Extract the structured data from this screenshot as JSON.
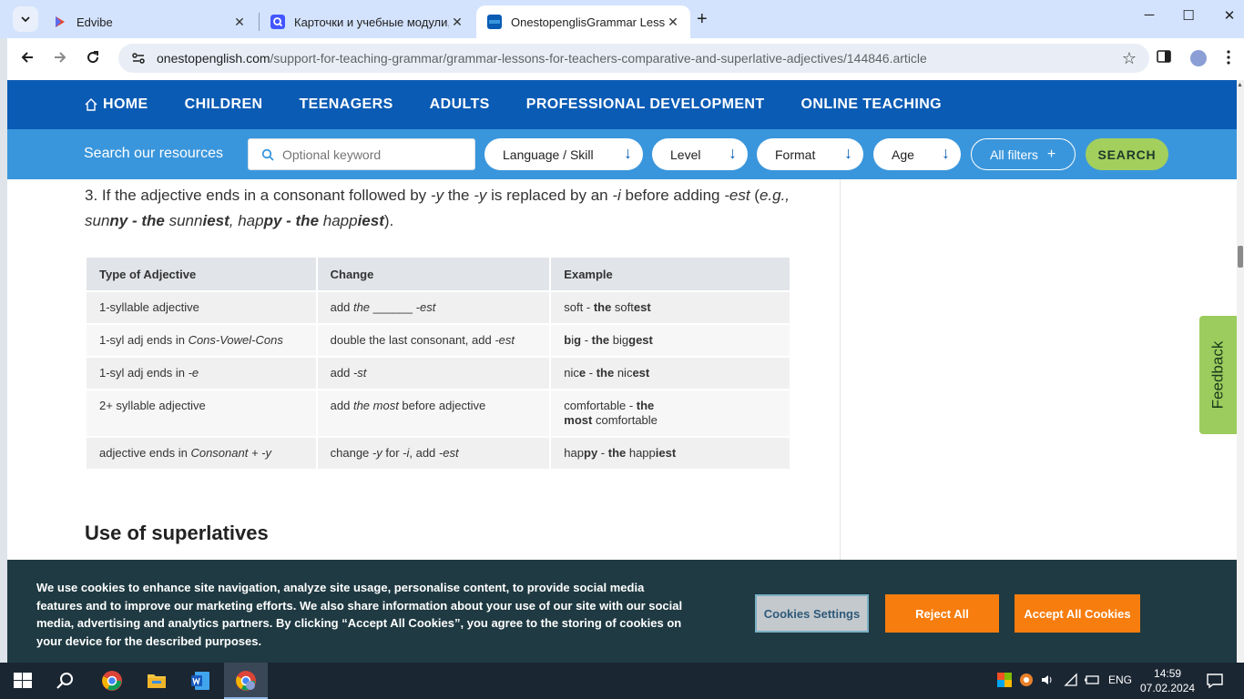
{
  "browser": {
    "tabs": [
      {
        "title": "Edvibe",
        "active": false
      },
      {
        "title": "Карточки и учебные модули, с",
        "active": false
      },
      {
        "title": "OnestopenglisGrammar Lesson",
        "active": true
      }
    ],
    "url_host": "onestopenglish.com",
    "url_path": "/support-for-teaching-grammar/grammar-lessons-for-teachers-comparative-and-superlative-adjectives/144846.article"
  },
  "site": {
    "nav": [
      "HOME",
      "CHILDREN",
      "TEENAGERS",
      "ADULTS",
      "PROFESSIONAL DEVELOPMENT",
      "ONLINE TEACHING"
    ],
    "search_label": "Search our resources",
    "keyword_placeholder": "Optional keyword",
    "filters": [
      "Language / Skill",
      "Level",
      "Format",
      "Age"
    ],
    "all_filters": "All filters",
    "search_button": "SEARCH"
  },
  "article": {
    "table": {
      "headers": [
        "Type of Adjective",
        "Change",
        "Example"
      ]
    },
    "subheading": "Use of superlatives"
  },
  "feedback": "Feedback",
  "cookie": {
    "text": "We use cookies to enhance site navigation, analyze site usage, personalise content, to provide social media features and to improve our marketing efforts. We also share information about your use of our site with our social media, advertising and analytics partners. By clicking “Accept All Cookies”, you agree to the storing of cookies on your device for the described purposes.",
    "settings": "Cookies Settings",
    "reject": "Reject All",
    "accept": "Accept All Cookies"
  },
  "taskbar": {
    "lang": "ENG",
    "time": "14:59",
    "date": "07.02.2024"
  },
  "colors": {
    "nav_bg": "#0a5bb4",
    "search_bg": "#3a96dc",
    "search_button": "#a3cf5d",
    "cookie_bg": "#1f3a42",
    "cookie_button": "#f77d0e"
  }
}
